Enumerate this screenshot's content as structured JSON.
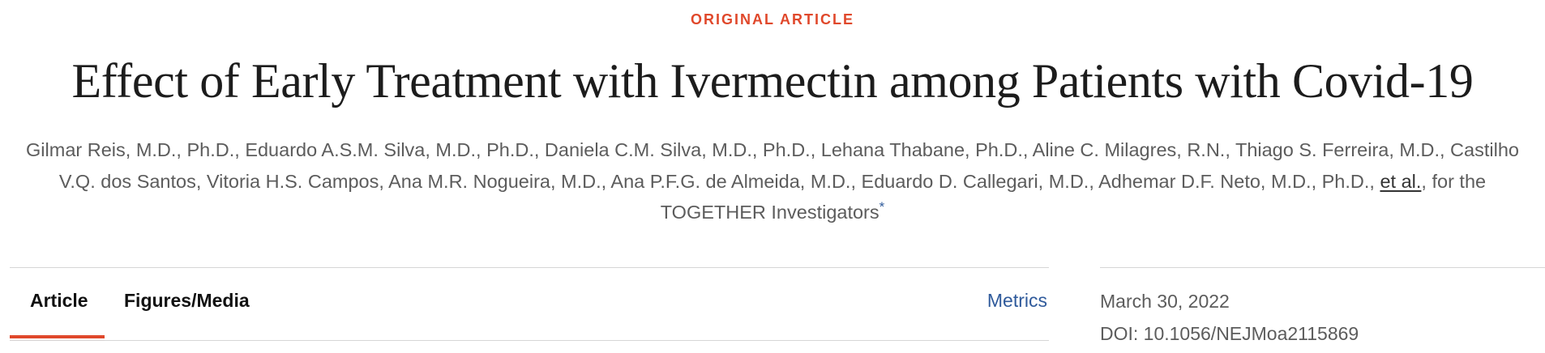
{
  "article": {
    "kicker": "ORIGINAL ARTICLE",
    "title": "Effect of Early Treatment with Ivermectin among Patients with Covid-19",
    "authors_text": "Gilmar Reis, M.D., Ph.D., Eduardo A.S.M. Silva, M.D., Ph.D., Daniela C.M. Silva, M.D., Ph.D., Lehana Thabane, Ph.D., Aline C. Milagres, R.N., Thiago S. Ferreira, M.D., Castilho V.Q. dos Santos, Vitoria H.S. Campos, Ana M.R. Nogueira, M.D., Ana P.F.G. de Almeida, M.D., Eduardo D. Callegari, M.D., Adhemar D.F. Neto, M.D., Ph.D., ",
    "et_al": "et al.",
    "group_text": ", for the TOGETHER Investigators",
    "asterisk": "*"
  },
  "tabs": [
    {
      "label": "Article",
      "active": true
    },
    {
      "label": "Figures/Media",
      "active": false
    }
  ],
  "metrics_label": "Metrics",
  "meta": {
    "date": "March 30, 2022",
    "doi": "DOI: 10.1056/NEJMoa2115869"
  },
  "colors": {
    "accent": "#e0482b",
    "link": "#2f5a9b"
  }
}
